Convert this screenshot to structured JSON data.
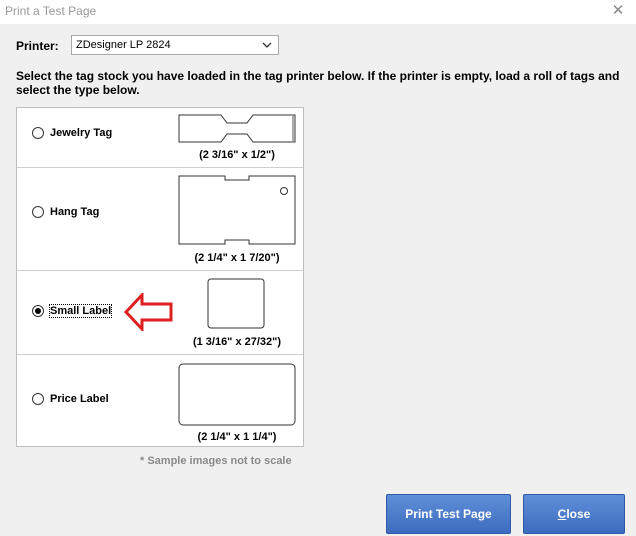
{
  "window": {
    "title": "Print a Test Page",
    "close_glyph": "✕"
  },
  "printer": {
    "label": "Printer:",
    "selected": "ZDesigner LP 2824"
  },
  "instructions": "Select the tag stock you have loaded in the tag printer below. If the printer is empty, load a roll of tags and select the type below.",
  "options": [
    {
      "label": "Jewelry Tag",
      "dims": "(2 3/16\" x 1/2\")",
      "checked": false
    },
    {
      "label": "Hang Tag",
      "dims": "(2 1/4\" x 1 7/20\")",
      "checked": false
    },
    {
      "label": "Small Label",
      "dims": "(1 3/16\" x 27/32\")",
      "checked": true
    },
    {
      "label": "Price Label",
      "dims": "(2 1/4\" x 1 1/4\")",
      "checked": false
    }
  ],
  "note": "* Sample images not to scale",
  "buttons": {
    "print": "Print Test Page",
    "close_prefix": "C",
    "close_rest": "lose"
  },
  "colors": {
    "button": "#4a7acb",
    "arrow": "#e02020"
  }
}
